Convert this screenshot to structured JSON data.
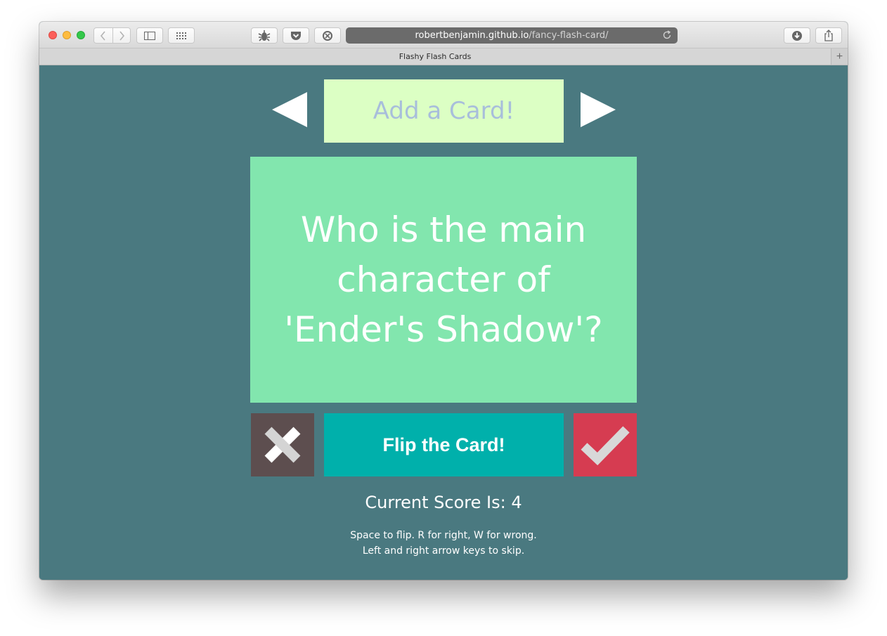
{
  "browser": {
    "url_host": "robertbenjamin.github.io",
    "url_path": "/fancy-flash-card/",
    "tab_title": "Flashy Flash Cards",
    "new_tab_label": "+"
  },
  "app": {
    "add_card_label": "Add a Card!",
    "card_text": "Who is the main character of 'Ender's Shadow'?",
    "flip_label": "Flip the Card!",
    "score_label": "Current Score Is: 4",
    "help_line1": "Space to flip. R for right, W for wrong.",
    "help_line2": "Left and right arrow keys to skip."
  },
  "colors": {
    "background": "#4a7980",
    "add_card_bg": "#dcffc4",
    "add_card_text": "#a8bedb",
    "card_bg": "#82e6ae",
    "wrong_bg": "#5d4e4f",
    "flip_bg": "#00b0ab",
    "right_bg": "#d63c51"
  },
  "icons": {
    "prev": "triangle-left-icon",
    "next": "triangle-right-icon",
    "wrong": "x-icon",
    "right": "checkmark-icon"
  }
}
